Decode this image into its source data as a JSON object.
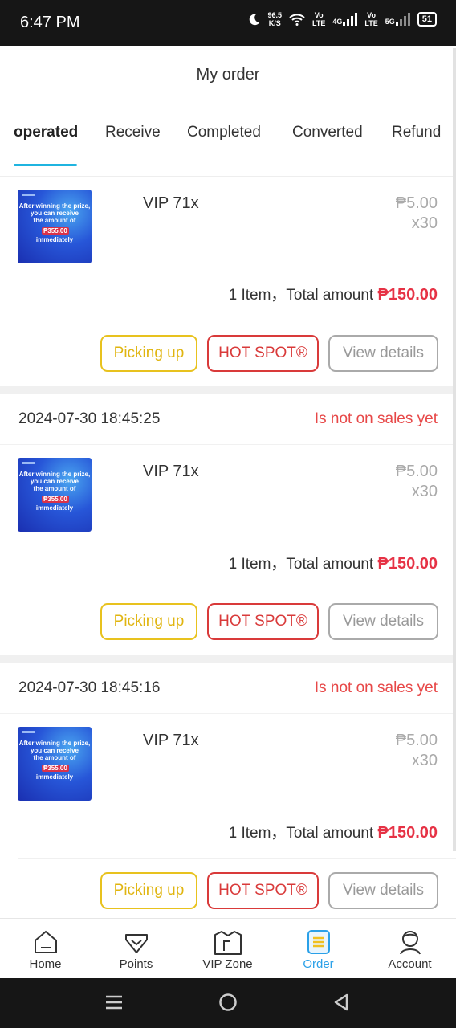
{
  "status_bar": {
    "time": "6:47 PM",
    "speed_value": "96.5",
    "speed_unit": "K/S",
    "net1_top": "Vo",
    "net1_bottom": "LTE",
    "net2": "4G",
    "net3_top": "Vo",
    "net3_bottom": "LTE",
    "net4": "5G",
    "battery": "51",
    "icons": [
      "moon-icon",
      "wifi-icon",
      "signal-icon",
      "battery-icon"
    ]
  },
  "header": {
    "title": "My order"
  },
  "tabs": [
    {
      "label": "operated",
      "active": true
    },
    {
      "label": "Receive",
      "active": false
    },
    {
      "label": "Completed",
      "active": false
    },
    {
      "label": "Converted",
      "active": false
    },
    {
      "label": "Refund",
      "active": false
    }
  ],
  "orders": [
    {
      "time": "",
      "status": "",
      "thumb_lines": [
        "After winning the prize,",
        "you can receive",
        "the amount of",
        "₱355.00",
        "immediately"
      ],
      "product_name": "VIP 71x",
      "unit_price": "₱5.00",
      "quantity": "x30",
      "summary_prefix": "1 Item，Total amount ",
      "total": "₱150.00",
      "buttons": {
        "pick": "Picking up",
        "hot": "HOT SPOT®",
        "view": "View details"
      }
    },
    {
      "time": "2024-07-30 18:45:25",
      "status": "Is not on sales yet",
      "thumb_lines": [
        "After winning the prize,",
        "you can receive",
        "the amount of",
        "₱355.00",
        "immediately"
      ],
      "product_name": "VIP 71x",
      "unit_price": "₱5.00",
      "quantity": "x30",
      "summary_prefix": "1 Item，Total amount ",
      "total": "₱150.00",
      "buttons": {
        "pick": "Picking up",
        "hot": "HOT SPOT®",
        "view": "View details"
      }
    },
    {
      "time": "2024-07-30 18:45:16",
      "status": "Is not on sales yet",
      "thumb_lines": [
        "After winning the prize,",
        "you can receive",
        "the amount of",
        "₱355.00",
        "immediately"
      ],
      "product_name": "VIP 71x",
      "unit_price": "₱5.00",
      "quantity": "x30",
      "summary_prefix": "1 Item，Total amount ",
      "total": "₱150.00",
      "buttons": {
        "pick": "Picking up",
        "hot": "HOT SPOT®",
        "view": "View details"
      }
    }
  ],
  "bottom_nav": [
    {
      "label": "Home",
      "icon": "home-icon",
      "active": false
    },
    {
      "label": "Points",
      "icon": "gem-icon",
      "active": false
    },
    {
      "label": "VIP Zone",
      "icon": "vip-zone-icon",
      "active": false
    },
    {
      "label": "Order",
      "icon": "order-list-icon",
      "active": true
    },
    {
      "label": "Account",
      "icon": "user-icon",
      "active": false
    }
  ],
  "colors": {
    "accent": "#1fb4e0",
    "price_red": "#e63245",
    "status_red": "#e74848",
    "pick_yellow": "#e8c21e",
    "nav_active": "#2aa0e8"
  }
}
